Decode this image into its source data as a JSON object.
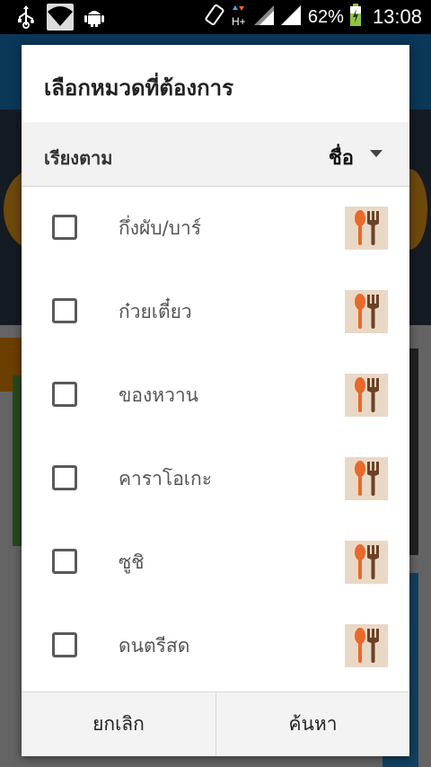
{
  "status_bar": {
    "icons_left": [
      "usb-icon",
      "wifi-icon",
      "android-icon"
    ],
    "icons_right": [
      "rotate-icon",
      "hplus-data-icon",
      "signal-icon",
      "signal-icon",
      "battery-icon"
    ],
    "battery": "62%",
    "time": "13:08"
  },
  "dialog": {
    "title": "เลือกหมวดที่ต้องการ",
    "sort_label": "เรียงตาม",
    "sort_value": "ชื่อ",
    "items": [
      {
        "label": "กึ่งผับ/บาร์",
        "checked": false,
        "icon": "restaurant-icon"
      },
      {
        "label": "ก๋วยเตี๋ยว",
        "checked": false,
        "icon": "restaurant-icon"
      },
      {
        "label": "ของหวาน",
        "checked": false,
        "icon": "restaurant-icon"
      },
      {
        "label": "คาราโอเกะ",
        "checked": false,
        "icon": "restaurant-icon"
      },
      {
        "label": "ซูชิ",
        "checked": false,
        "icon": "restaurant-icon"
      },
      {
        "label": "ดนตรีสด",
        "checked": false,
        "icon": "restaurant-icon"
      }
    ],
    "cancel_label": "ยกเลิก",
    "search_label": "ค้นหา"
  },
  "colors": {
    "header_blue": "#1a7bc4",
    "icon_bg": "#ead8c6",
    "icon_orange": "#e8692a",
    "icon_brown": "#6b4226"
  }
}
